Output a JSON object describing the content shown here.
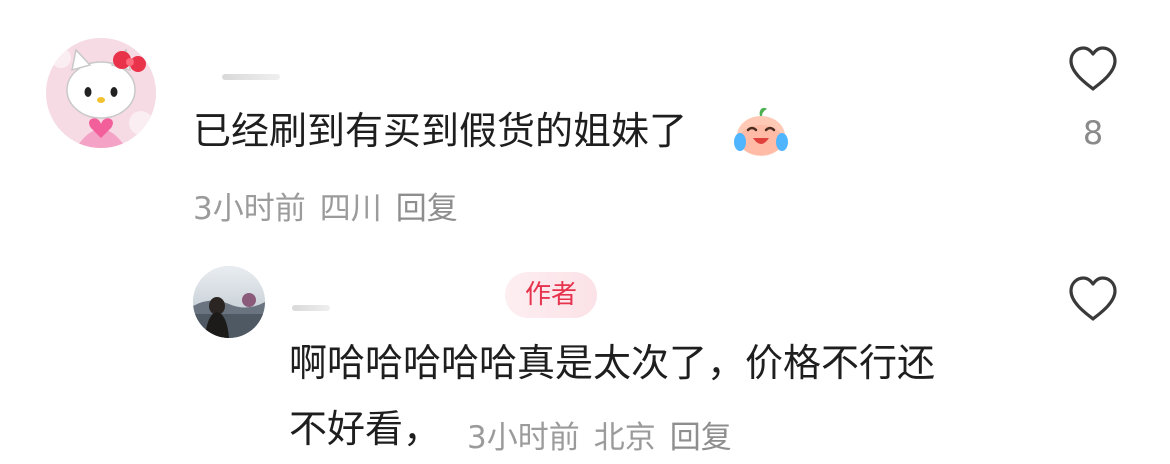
{
  "comment": {
    "text": "已经刷到有买到假货的姐妹了",
    "emoji": "crying-laughing-peach-emoji",
    "time": "3小时前",
    "location": "四川",
    "reply_label": "回复",
    "likes": "8"
  },
  "reply": {
    "badge": "作者",
    "text_line1": "啊哈哈哈哈哈真是太次了，价格不行还",
    "text_line2": "不好看，",
    "time": "3小时前",
    "location": "北京",
    "reply_label": "回复"
  },
  "colors": {
    "badge_text": "#e6334d",
    "badge_bg": "#fbe2e7",
    "meta": "#9b9b9b"
  }
}
